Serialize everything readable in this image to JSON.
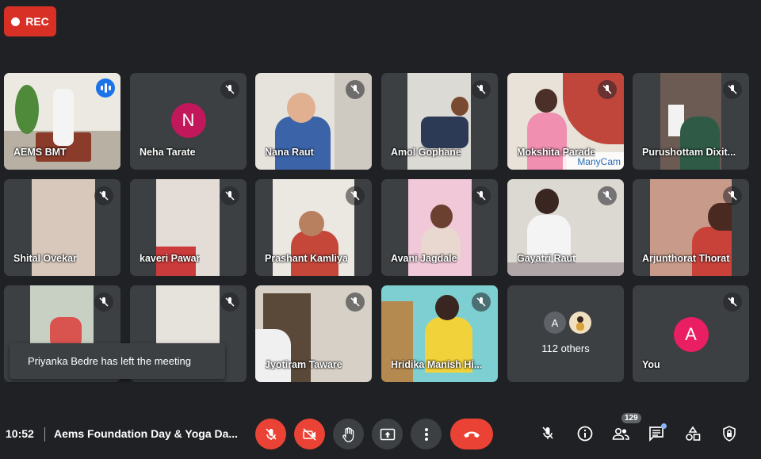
{
  "recording": {
    "label": "REC"
  },
  "tiles": [
    {
      "name": "AEMS BMT"
    },
    {
      "name": "Neha Tarate",
      "avatar": "N"
    },
    {
      "name": "Nana Raut"
    },
    {
      "name": "Amol Gophane"
    },
    {
      "name": "Mokshita Parade",
      "watermark": "ManyCam"
    },
    {
      "name": "Purushottam Dixit..."
    },
    {
      "name": "Shital Ovekar"
    },
    {
      "name": "kaveri Pawar"
    },
    {
      "name": "Prashant Kamliya"
    },
    {
      "name": "Avani Jagdale"
    },
    {
      "name": "Gayatri Raut"
    },
    {
      "name": "Arjunthorat Thorat"
    },
    {
      "name": ""
    },
    {
      "name": ""
    },
    {
      "name": "Jyotiram Taware"
    },
    {
      "name": "Hridika Manish Hi..."
    },
    {
      "others_label": "112 others",
      "avatar": "A"
    },
    {
      "name": "You",
      "avatar": "A"
    }
  ],
  "toast": {
    "text": "Priyanka Bedre has left the meeting"
  },
  "bottom_bar": {
    "time": "10:52",
    "meeting_title": "Aems Foundation Day & Yoga Da...",
    "people_count": "129"
  }
}
